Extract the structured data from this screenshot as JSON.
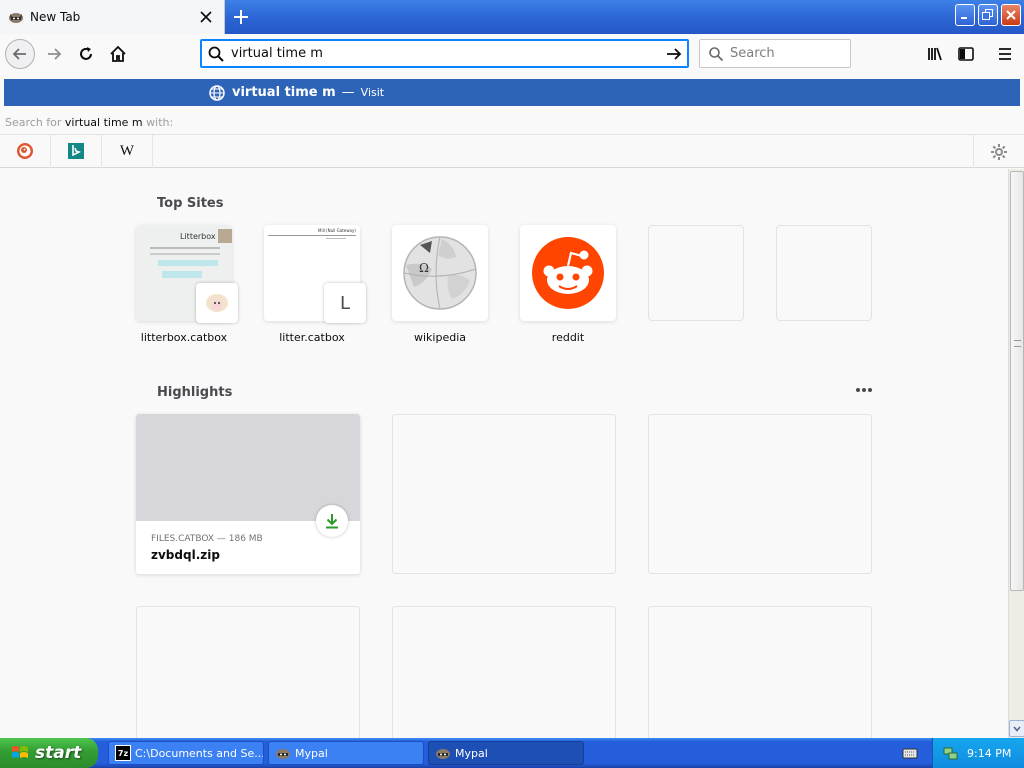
{
  "browser": {
    "tab": {
      "title": "New Tab",
      "favicon": "raccoon-icon"
    },
    "url_value": "virtual time m",
    "search_placeholder": "Search"
  },
  "popup": {
    "suggestion_title": "virtual time m",
    "separator": "—",
    "suggestion_action": "Visit",
    "search_for_prefix": "Search for",
    "search_for_query": "virtual time m",
    "search_for_suffix": "with:",
    "engines": [
      {
        "name": "DuckDuckGo",
        "icon": "duckduckgo-icon"
      },
      {
        "name": "Bing",
        "icon": "bing-icon"
      },
      {
        "name": "Wikipedia",
        "icon": "wikipedia-w-icon",
        "letter": "W"
      }
    ]
  },
  "top_sites": {
    "title": "Top Sites",
    "tiles": [
      {
        "label": "litterbox.catbox",
        "preview_heading": "Litterbox",
        "badge": "sheep-icon"
      },
      {
        "label": "litter.catbox",
        "preview_heading": "Mill (Null Gateway)",
        "badge_letter": "L"
      },
      {
        "label": "wikipedia",
        "icon": "wikipedia-globe-icon",
        "globe_letter": "Ω"
      },
      {
        "label": "reddit",
        "icon": "reddit-icon",
        "color": "#ff4500"
      },
      {
        "label": ""
      },
      {
        "label": ""
      }
    ]
  },
  "highlights": {
    "title": "Highlights",
    "more": "•••",
    "card": {
      "source": "FILES.CATBOX — 186 MB",
      "name": "zvbdql.zip",
      "icon": "download-icon"
    }
  },
  "taskbar": {
    "start_label": "start",
    "tasks": [
      {
        "label": "C:\\Documents and Se...",
        "icon": "7zip-icon",
        "icon_text": "7z"
      },
      {
        "label": "Mypal",
        "icon": "mypal-icon"
      },
      {
        "label": "Mypal",
        "icon": "mypal-icon"
      }
    ],
    "clock": "9:14 PM"
  },
  "colors": {
    "popup_highlight": "#2e64b8",
    "urlbar_focus": "#0a84ff",
    "xp_taskbar": "#245edb",
    "start_green": "#339d33",
    "reddit": "#ff4500",
    "download_green": "#2a9a2a"
  }
}
